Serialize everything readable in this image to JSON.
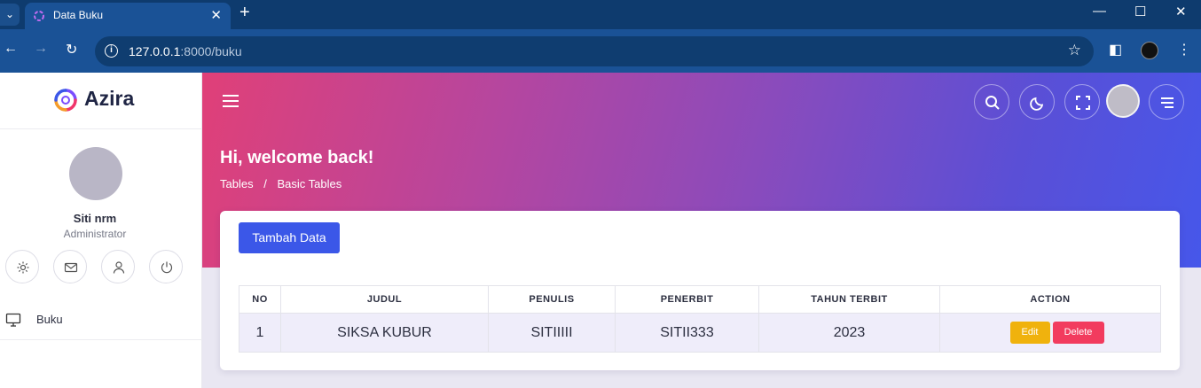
{
  "browser": {
    "tab_title": "Data Buku",
    "url_host": "127.0.0.1",
    "url_rest": ":8000/buku"
  },
  "sidebar": {
    "brand": "Azira",
    "user_name": "Siti nrm",
    "user_role": "Administrator",
    "menu": [
      {
        "label": "Buku",
        "icon": "monitor-icon"
      }
    ]
  },
  "header": {
    "welcome": "Hi, welcome back!",
    "breadcrumb": [
      "Tables",
      "Basic Tables"
    ],
    "breadcrumb_sep": "/"
  },
  "card": {
    "add_button": "Tambah Data",
    "columns": [
      "NO",
      "JUDUL",
      "PENULIS",
      "PENERBIT",
      "TAHUN TERBIT",
      "ACTION"
    ],
    "rows": [
      {
        "no": "1",
        "judul": "SIKSA KUBUR",
        "penulis": "SITIIIII",
        "penerbit": "SITII333",
        "tahun": "2023",
        "edit": "Edit",
        "delete": "Delete"
      }
    ]
  },
  "colors": {
    "accent": "#3b57e8",
    "edit": "#f0b20d",
    "delete": "#f23b5e",
    "chrome": "#1a5296"
  }
}
